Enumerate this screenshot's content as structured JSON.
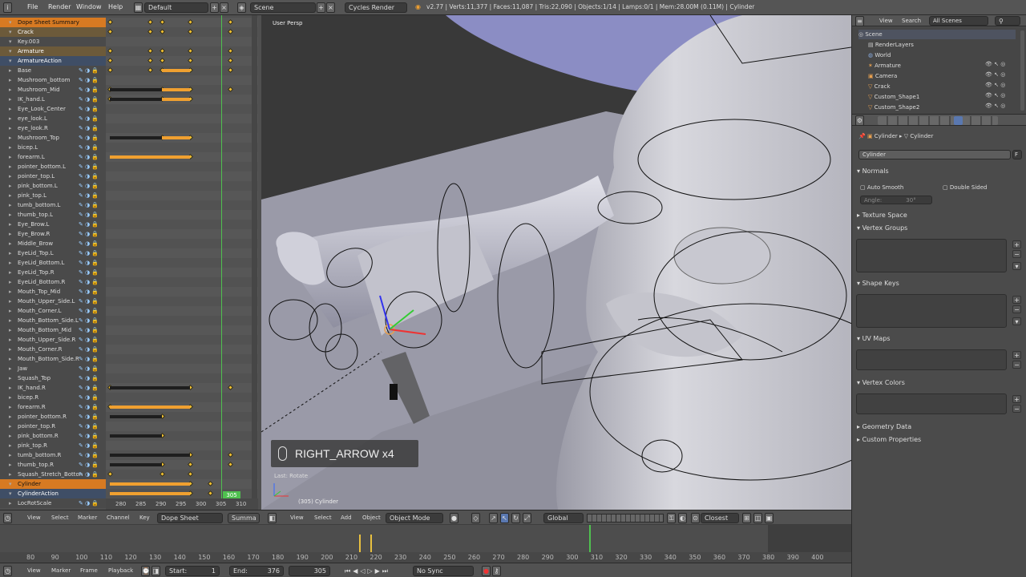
{
  "topbar": {
    "menus": [
      "File",
      "Render",
      "Window",
      "Help"
    ],
    "layout": "Default",
    "scene": "Scene",
    "engine": "Cycles Render",
    "stats": "v2.77 | Verts:11,377 | Faces:11,087 | Tris:22,090 | Objects:1/14 | Lamps:0/1 | Mem:28.00M (0.11M) | Cylinder"
  },
  "dopesheet": {
    "channels": [
      {
        "label": "Dope Sheet Summary",
        "kind": "sel"
      },
      {
        "label": "Crack",
        "kind": "grp"
      },
      {
        "label": "Key.003",
        "kind": "sub"
      },
      {
        "label": "Armature",
        "kind": "grp"
      },
      {
        "label": "ArmatureAction",
        "kind": "grp2"
      },
      {
        "label": "Base",
        "kind": "bone"
      },
      {
        "label": "Mushroom_bottom",
        "kind": "bone"
      },
      {
        "label": "Mushroom_Mid",
        "kind": "bone"
      },
      {
        "label": "IK_hand.L",
        "kind": "bone"
      },
      {
        "label": "Eye_Look_Center",
        "kind": "bone"
      },
      {
        "label": "eye_look.L",
        "kind": "bone"
      },
      {
        "label": "eye_look.R",
        "kind": "bone"
      },
      {
        "label": "Mushroom_Top",
        "kind": "bone"
      },
      {
        "label": "bicep.L",
        "kind": "bone"
      },
      {
        "label": "forearm.L",
        "kind": "bone"
      },
      {
        "label": "pointer_bottom.L",
        "kind": "bone"
      },
      {
        "label": "pointer_top.L",
        "kind": "bone"
      },
      {
        "label": "pink_bottom.L",
        "kind": "bone"
      },
      {
        "label": "pink_top.L",
        "kind": "bone"
      },
      {
        "label": "tumb_bottom.L",
        "kind": "bone"
      },
      {
        "label": "thumb_top.L",
        "kind": "bone"
      },
      {
        "label": "Eye_Brow.L",
        "kind": "bone"
      },
      {
        "label": "Eye_Brow.R",
        "kind": "bone"
      },
      {
        "label": "Middle_Brow",
        "kind": "bone"
      },
      {
        "label": "EyeLid_Top.L",
        "kind": "bone"
      },
      {
        "label": "EyeLid_Bottom.L",
        "kind": "bone"
      },
      {
        "label": "EyeLid_Top.R",
        "kind": "bone"
      },
      {
        "label": "EyeLid_Bottom.R",
        "kind": "bone"
      },
      {
        "label": "Mouth_Top_Mid",
        "kind": "bone"
      },
      {
        "label": "Mouth_Upper_Side.L",
        "kind": "bone"
      },
      {
        "label": "Mouth_Corner.L",
        "kind": "bone"
      },
      {
        "label": "Mouth_Bottom_Side.L",
        "kind": "bone"
      },
      {
        "label": "Mouth_Bottom_Mid",
        "kind": "bone"
      },
      {
        "label": "Mouth_Upper_Side.R",
        "kind": "bone"
      },
      {
        "label": "Mouth_Corner.R",
        "kind": "bone"
      },
      {
        "label": "Mouth_Bottom_Side.R",
        "kind": "bone"
      },
      {
        "label": "Jaw",
        "kind": "bone"
      },
      {
        "label": "Squash_Top",
        "kind": "bone"
      },
      {
        "label": "IK_hand.R",
        "kind": "bone"
      },
      {
        "label": "bicep.R",
        "kind": "bone"
      },
      {
        "label": "forearm.R",
        "kind": "bone"
      },
      {
        "label": "pointer_bottom.R",
        "kind": "bone"
      },
      {
        "label": "pointer_top.R",
        "kind": "bone"
      },
      {
        "label": "pink_bottom.R",
        "kind": "bone"
      },
      {
        "label": "pink_top.R",
        "kind": "bone"
      },
      {
        "label": "tumb_bottom.R",
        "kind": "bone"
      },
      {
        "label": "thumb_top.R",
        "kind": "bone"
      },
      {
        "label": "Squash_Stretch_Botton",
        "kind": "bone"
      },
      {
        "label": "Cylinder",
        "kind": "sel"
      },
      {
        "label": "CylinderAction",
        "kind": "grp2"
      },
      {
        "label": "LocRotScale",
        "kind": "bone"
      }
    ],
    "frame_ticks": [
      "280",
      "285",
      "290",
      "295",
      "300",
      "305",
      "310"
    ],
    "current_frame": "305",
    "header": {
      "menus": [
        "View",
        "Select",
        "Marker",
        "Channel",
        "Key"
      ],
      "mode": "Dope Sheet",
      "summary": "Summa"
    }
  },
  "viewport": {
    "label": "User Persp",
    "key_overlay": "RIGHT_ARROW x4",
    "last_op": "Last: Rotate",
    "object_info": "(305) Cylinder",
    "header": {
      "menus": [
        "View",
        "Select",
        "Add",
        "Object"
      ],
      "mode": "Object Mode",
      "orientation": "Global",
      "snap": "Closest"
    }
  },
  "outliner": {
    "header": {
      "view": "View",
      "search": "Search",
      "scope": "All Scenes"
    },
    "items": [
      "Scene",
      "RenderLayers",
      "World",
      "Armature",
      "Camera",
      "Crack",
      "Custom_Shape1",
      "Custom_Shape2"
    ]
  },
  "properties": {
    "breadcrumb": [
      "Cylinder",
      "Cylinder"
    ],
    "mesh_name": "Cylinder",
    "fake_user": "F",
    "panels": {
      "normals": "Normals",
      "auto_smooth": "Auto Smooth",
      "double_sided": "Double Sided",
      "angle_label": "Angle:",
      "angle_value": "30°",
      "texture_space": "Texture Space",
      "vertex_groups": "Vertex Groups",
      "shape_keys": "Shape Keys",
      "uv_maps": "UV Maps",
      "vertex_colors": "Vertex Colors",
      "geometry_data": "Geometry Data",
      "custom_properties": "Custom Properties"
    }
  },
  "timeline": {
    "ticks": [
      "80",
      "90",
      "100",
      "110",
      "120",
      "130",
      "140",
      "150",
      "160",
      "170",
      "180",
      "190",
      "200",
      "210",
      "220",
      "230",
      "240",
      "250",
      "260",
      "270",
      "280",
      "290",
      "300",
      "310",
      "320",
      "330",
      "340",
      "350",
      "360",
      "370",
      "380",
      "390",
      "400"
    ],
    "menus": [
      "View",
      "Marker",
      "Frame",
      "Playback"
    ],
    "start_label": "Start:",
    "start": "1",
    "end_label": "End:",
    "end": "376",
    "current": "305",
    "sync": "No Sync"
  },
  "colors": {
    "keyframe": "#f0a030",
    "selected": "#d77a22",
    "current_frame_line": "#4fc04f"
  }
}
